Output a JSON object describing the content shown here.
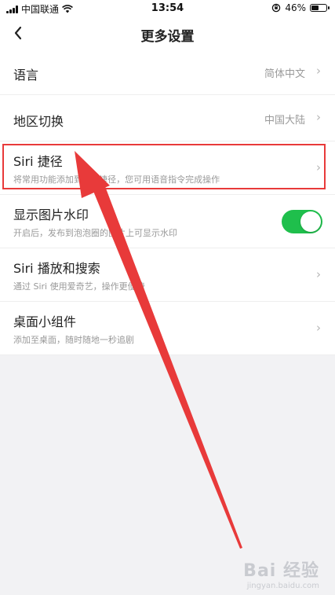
{
  "status_bar": {
    "carrier": "中国联通",
    "time": "13:54",
    "battery_percent": "46%"
  },
  "nav": {
    "title": "更多设置"
  },
  "settings": {
    "language": {
      "label": "语言",
      "value": "简体中文"
    },
    "region": {
      "label": "地区切换",
      "value": "中国大陆"
    },
    "siri_shortcut": {
      "label": "Siri 捷径",
      "desc": "将常用功能添加到Siri 捷径，您可用语音指令完成操作"
    },
    "watermark": {
      "label": "显示图片水印",
      "desc": "开启后，发布到泡泡圈的图片上可显示水印",
      "enabled": true
    },
    "siri_search": {
      "label": "Siri 播放和搜索",
      "desc": "通过 Siri 使用爱奇艺，操作更便捷"
    },
    "widget": {
      "label": "桌面小组件",
      "desc": "添加至桌面，随时随地一秒追剧"
    }
  },
  "watermark_overlay": {
    "logo": "Bai 经验",
    "url": "jingyan.baidu.com"
  },
  "colors": {
    "toggle_on": "#1fbf4c",
    "highlight": "#e83a3a"
  },
  "icons": [
    "wifi-icon",
    "orientation-lock-icon",
    "battery-icon",
    "back-chevron-icon",
    "chevron-right-icon"
  ]
}
